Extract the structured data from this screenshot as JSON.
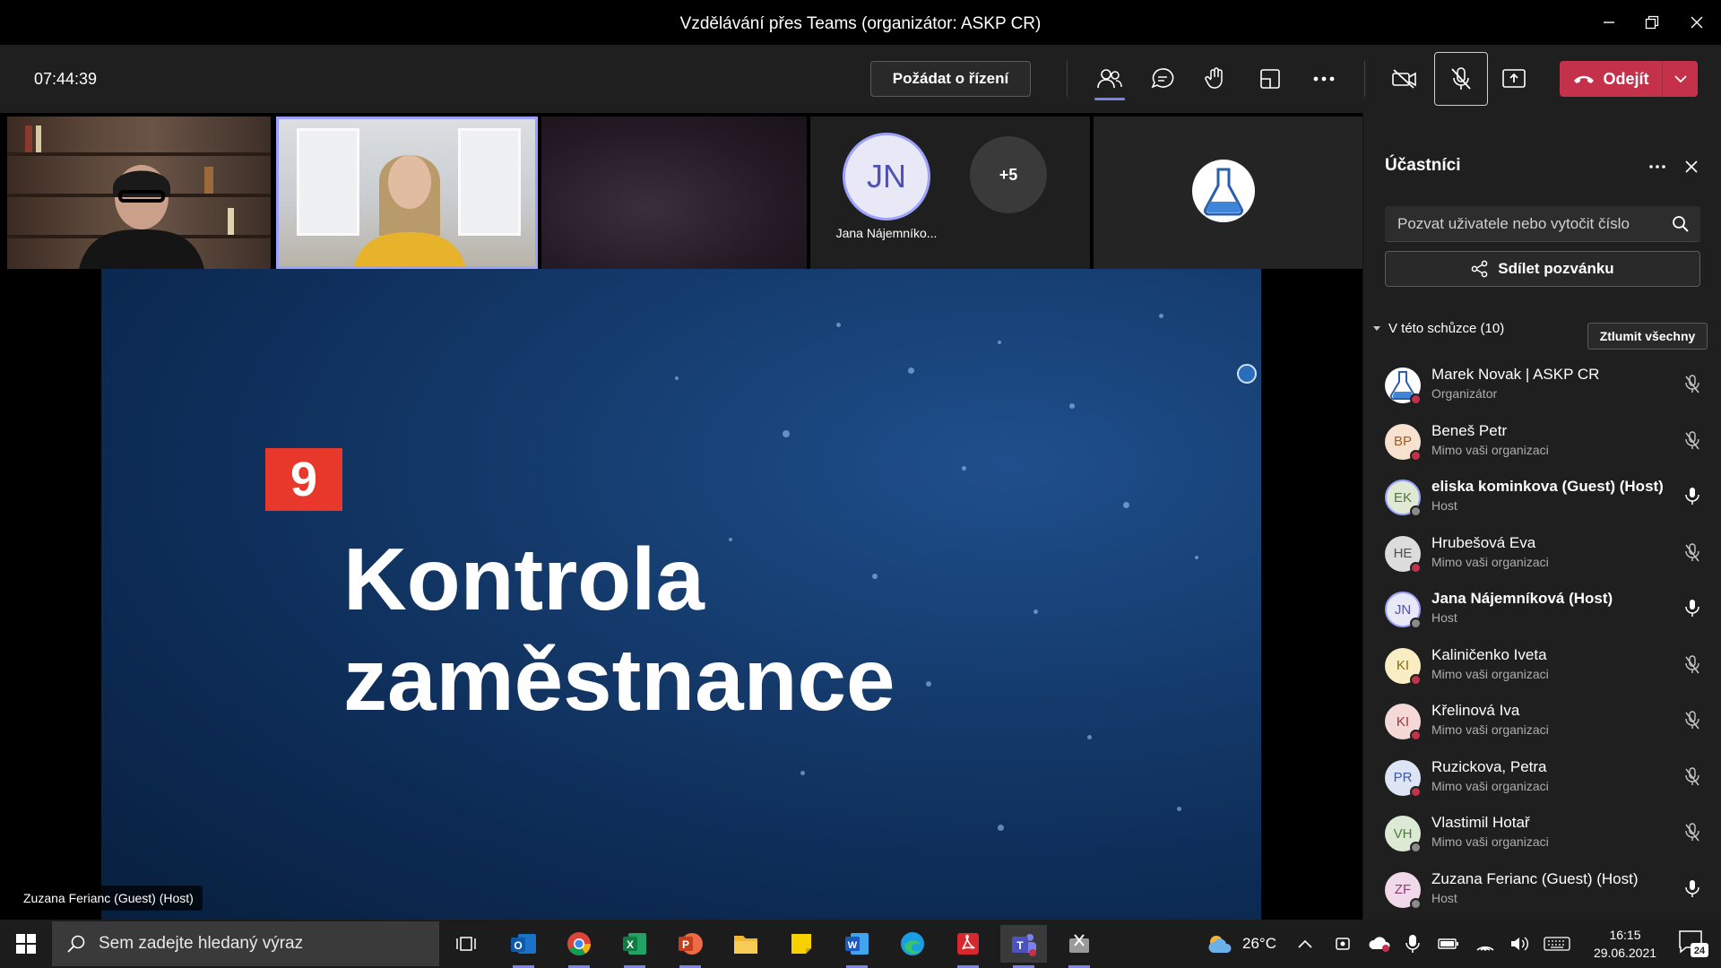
{
  "window": {
    "title": "Vzdělávání přes Teams (organizátor: ASKP CR)"
  },
  "toolbar": {
    "timer": "07:44:39",
    "request_control_label": "Požádat o řízení",
    "leave_label": "Odejít"
  },
  "stage": {
    "jn_initials": "JN",
    "jn_name": "Jana Nájemníko...",
    "more_count": "+5",
    "presenter_name": "Zuzana Ferianc (Guest) (Host)"
  },
  "slide": {
    "number": "9",
    "title_line1": "Kontrola",
    "title_line2": "zaměstnance"
  },
  "panel": {
    "title": "Účastníci",
    "invite_placeholder": "Pozvat uživatele nebo vytočit číslo",
    "share_label": "Sdílet pozvánku",
    "section_label": "V této schůzce (10)",
    "mute_all_label": "Ztlumit všechny",
    "participants": [
      {
        "initials": "",
        "name": "Marek Novak | ASKP CR",
        "role": "Organizátor",
        "bold": false,
        "muted": true,
        "status": "#c4314b"
      },
      {
        "initials": "BP",
        "name": "Beneš Petr",
        "role": "Mimo vaši organizaci",
        "bold": false,
        "muted": true,
        "status": "#c4314b"
      },
      {
        "initials": "EK",
        "name": "eliska kominkova (Guest) (Host)",
        "role": "Host",
        "bold": true,
        "muted": false,
        "status": "#8a8a8a"
      },
      {
        "initials": "HE",
        "name": "Hrubešová Eva",
        "role": "Mimo vaši organizaci",
        "bold": false,
        "muted": true,
        "status": "#c4314b"
      },
      {
        "initials": "JN",
        "name": "Jana Nájemníková (Host)",
        "role": "Host",
        "bold": true,
        "muted": false,
        "status": "#8a8a8a"
      },
      {
        "initials": "KI",
        "name": "Kaliničenko Iveta",
        "role": "Mimo vaši organizaci",
        "bold": false,
        "muted": true,
        "status": "#c4314b"
      },
      {
        "initials": "KI",
        "name": "Křelinová Iva",
        "role": "Mimo vaši organizaci",
        "bold": false,
        "muted": true,
        "status": "#c4314b"
      },
      {
        "initials": "PR",
        "name": "Ruzickova, Petra",
        "role": "Mimo vaši organizaci",
        "bold": false,
        "muted": true,
        "status": "#c4314b"
      },
      {
        "initials": "VH",
        "name": "Vlastimil Hotař",
        "role": "Mimo vaši organizaci",
        "bold": false,
        "muted": true,
        "status": "#8a8a8a"
      },
      {
        "initials": "ZF",
        "name": "Zuzana Ferianc (Guest) (Host)",
        "role": "Host",
        "bold": false,
        "muted": false,
        "status": "#8a8a8a"
      }
    ]
  },
  "taskbar": {
    "search_placeholder": "Sem zadejte hledaný výraz",
    "weather": "26°C",
    "time": "16:15",
    "date": "29.06.2021",
    "notification_count": "24"
  },
  "colors": {
    "accent": "#7b83eb",
    "leave": "#c4314b",
    "slide_badge": "#e8372b"
  }
}
